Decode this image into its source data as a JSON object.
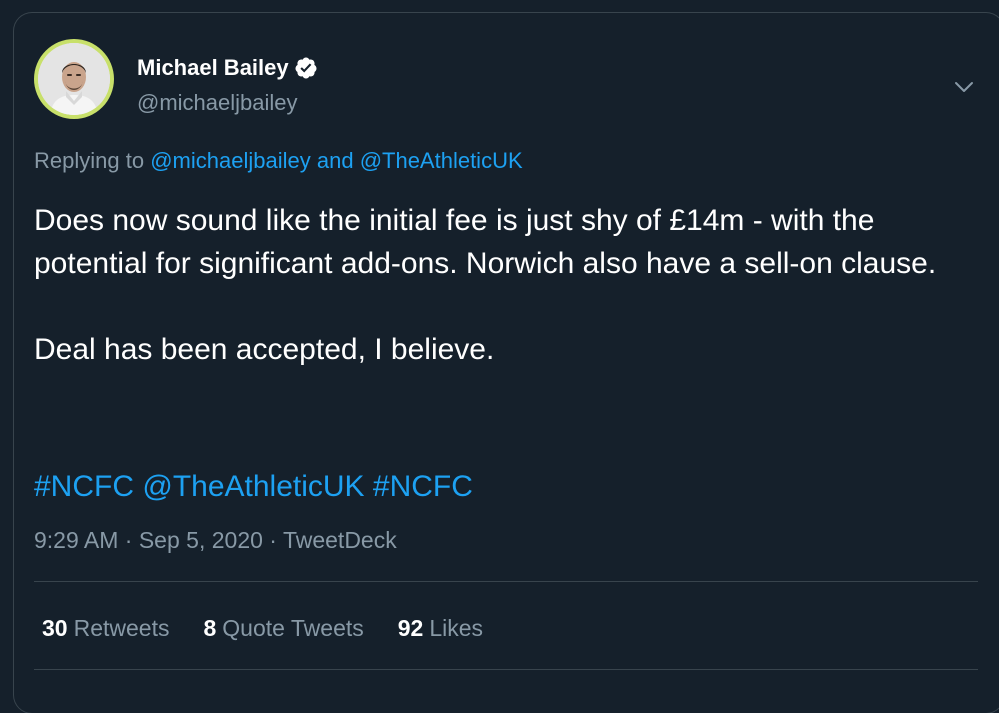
{
  "tweet": {
    "author": {
      "name": "Michael Bailey",
      "handle": "@michaeljbailey",
      "verified": true
    },
    "replying": {
      "prefix": "Replying to",
      "user1": "@michaeljbailey",
      "conjunction": "and",
      "user2": "@TheAthleticUK"
    },
    "body": {
      "paragraph1": "Does now sound like the initial fee is just shy of £14m - with the potential for significant add-ons. Norwich also have a sell-on clause.",
      "paragraph2": "Deal has been accepted, I believe."
    },
    "tags": {
      "tag1": "#NCFC",
      "mention": "@TheAthleticUK",
      "tag2": "#NCFC"
    },
    "meta": {
      "time": "9:29 AM",
      "separator": "·",
      "date": "Sep 5, 2020",
      "source": "TweetDeck"
    },
    "stats": {
      "retweets_count": "30",
      "retweets_label": "Retweets",
      "quotes_count": "8",
      "quotes_label": "Quote Tweets",
      "likes_count": "92",
      "likes_label": "Likes"
    }
  },
  "colors": {
    "background": "#15202b",
    "text": "#ffffff",
    "secondary": "#8899a6",
    "link": "#1da1f2",
    "divider": "#38444d",
    "avatar_ring": "#c8e06a"
  },
  "icons": {
    "verified": "verified-badge-icon",
    "more": "chevron-down-icon"
  }
}
